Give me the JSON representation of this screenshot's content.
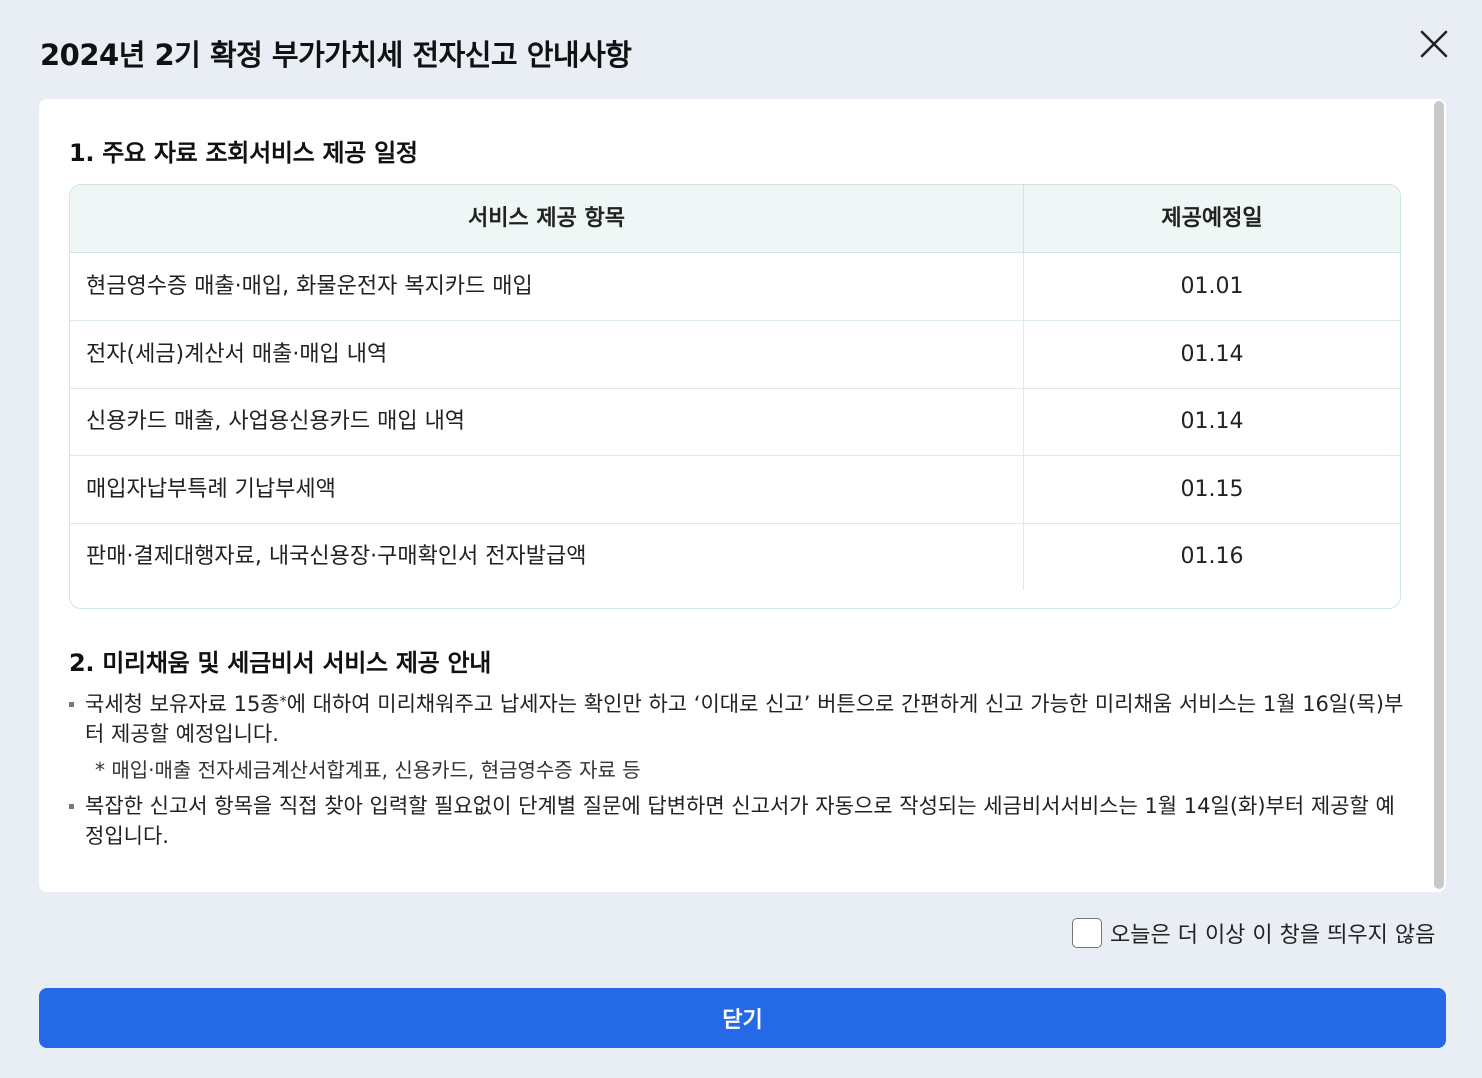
{
  "modal": {
    "title": "2024년 2기 확정 부가가치세 전자신고 안내사항",
    "close_icon": "close-icon"
  },
  "section1": {
    "title": "1. 주요 자료 조회서비스 제공 일정",
    "table": {
      "headers": [
        "서비스 제공 항목",
        "제공예정일"
      ],
      "rows": [
        {
          "item": "현금영수증 매출·매입, 화물운전자 복지카드 매입",
          "date": "01.01"
        },
        {
          "item": "전자(세금)계산서 매출·매입 내역",
          "date": "01.14"
        },
        {
          "item": "신용카드 매출, 사업용신용카드 매입 내역",
          "date": "01.14"
        },
        {
          "item": "매입자납부특례 기납부세액",
          "date": "01.15"
        },
        {
          "item": "판매·결제대행자료, 내국신용장·구매확인서 전자발급액",
          "date": "01.16"
        }
      ]
    }
  },
  "section2": {
    "title": "2. 미리채움 및 세금비서 서비스 제공 안내",
    "note1_before": "국세청 보유자료 15종",
    "note1_mark": "*",
    "note1_after": "에 대하여 미리채워주고 납세자는 확인만 하고 ‘이대로 신고’ 버튼으로 간편하게 신고 가능한 미리채움 서비스는 1월 16일(목)부터 제공할 예정입니다.",
    "note1_sub": "* 매입·매출 전자세금계산서합계표, 신용카드, 현금영수증 자료 등",
    "note2": "복잡한 신고서 항목을 직접 찾아 입력할 필요없이 단계별 질문에 답변하면 신고서가 자동으로 작성되는 세금비서서비스는 1월 14일(화)부터 제공할 예정입니다."
  },
  "footer": {
    "dont_show_label": "오늘은 더 이상 이 창을 띄우지 않음",
    "dont_show_checked": false,
    "close_button_label": "닫기"
  },
  "colors": {
    "primary_button": "#2469e6",
    "table_header_bg": "#eef7f6",
    "table_border": "#cfe5e2",
    "modal_bg": "#e9eef5"
  }
}
